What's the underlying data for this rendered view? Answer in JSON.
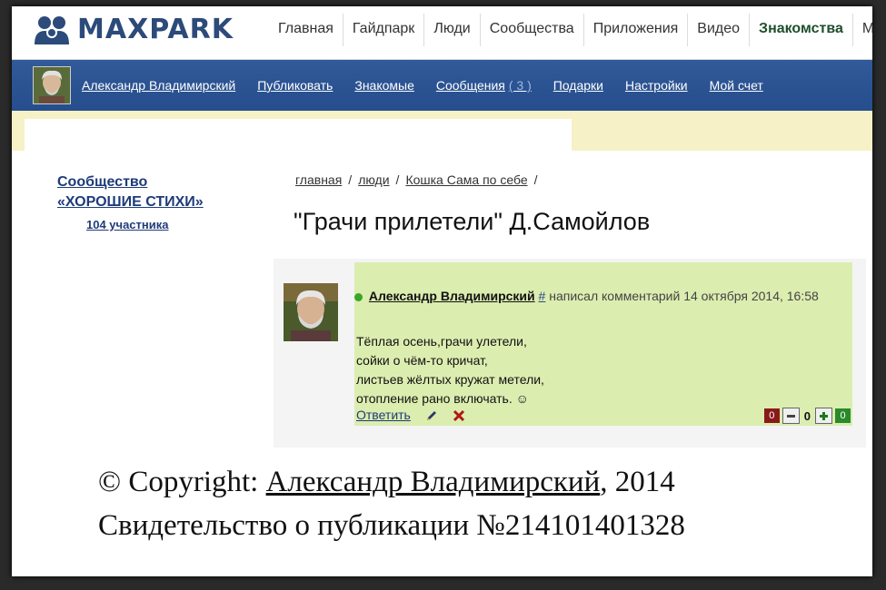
{
  "brand": {
    "name": "MAXPARK"
  },
  "top_nav": [
    "Главная",
    "Гайдпарк",
    "Люди",
    "Сообщества",
    "Приложения",
    "Видео",
    "Знакомства",
    "М"
  ],
  "user_bar": {
    "user_name": "Александр Владимирский",
    "publish": "Публиковать",
    "acquaintances": "Знакомые",
    "messages": "Сообщения",
    "messages_count": "( 3 )",
    "gifts": "Подарки",
    "settings": "Настройки",
    "account": "Мой счет"
  },
  "sidebar": {
    "community_line1": "Сообщество",
    "community_line2": "«ХОРОШИЕ СТИХИ»",
    "members": "104 участника"
  },
  "breadcrumb": [
    "главная",
    "люди",
    "Кошка Сама по себе"
  ],
  "page_title": "\"Грачи прилетели\" Д.Самойлов",
  "comment": {
    "author": "Александр Владимирский",
    "hash": "#",
    "meta": "написал комментарий 14 октября 2014, 16:58",
    "lines": [
      "Тёплая осень,грачи улетели,",
      "сойки о чём-то кричат,",
      "листьев жёлтых кружат метели,",
      "отопление рано включать. ☺"
    ],
    "reply": "Ответить",
    "minus_count": "0",
    "score": "0",
    "plus_count": "0"
  },
  "footer": {
    "copyright_prefix": "© Copyright: ",
    "copyright_author": "Александр Владимирский",
    "copyright_suffix": ", 2014",
    "certificate": "Свидетельство о публикации №214101401328"
  },
  "colors": {
    "brand_blue": "#2c4a7a",
    "nav_blue": "#315a99",
    "comment_green": "#dcedb0",
    "yellow_strip": "#f6f1c7"
  }
}
